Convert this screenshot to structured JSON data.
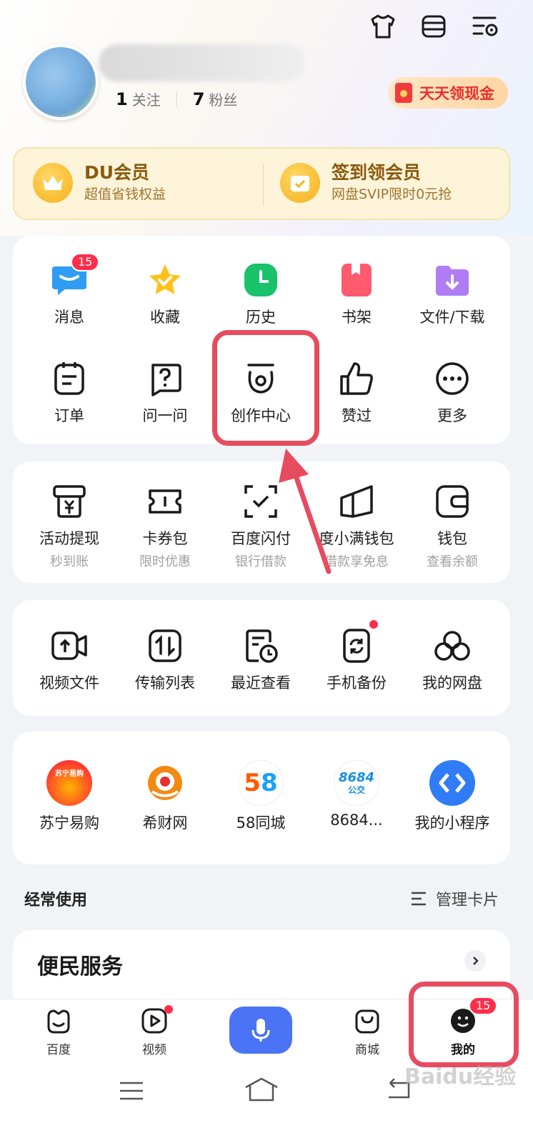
{
  "header": {
    "icons": [
      "shirt-icon",
      "list-icon",
      "settings-icon"
    ]
  },
  "profile": {
    "following_count": "1",
    "following_label": "关注",
    "followers_count": "7",
    "followers_label": "粉丝",
    "cash_button": "天天领现金"
  },
  "vip": {
    "left_title": "DU会员",
    "left_subtitle": "超值省钱权益",
    "right_title": "签到领会员",
    "right_subtitle": "网盘SVIP限时0元抢"
  },
  "quick": {
    "items": [
      {
        "label": "消息",
        "badge": "15"
      },
      {
        "label": "收藏"
      },
      {
        "label": "历史"
      },
      {
        "label": "书架"
      },
      {
        "label": "文件/下载"
      },
      {
        "label": "订单"
      },
      {
        "label": "问一问"
      },
      {
        "label": "创作中心"
      },
      {
        "label": "赞过"
      },
      {
        "label": "更多"
      }
    ]
  },
  "finance": {
    "items": [
      {
        "label": "活动提现",
        "sub": "秒到账"
      },
      {
        "label": "卡券包",
        "sub": "限时优惠"
      },
      {
        "label": "百度闪付",
        "sub": "银行借款"
      },
      {
        "label": "度小满钱包",
        "sub": "借款享免息"
      },
      {
        "label": "钱包",
        "sub": "查看余额"
      }
    ]
  },
  "tools": {
    "items": [
      {
        "label": "视频文件"
      },
      {
        "label": "传输列表"
      },
      {
        "label": "最近查看"
      },
      {
        "label": "手机备份"
      },
      {
        "label": "我的网盘"
      }
    ]
  },
  "apps": {
    "items": [
      {
        "label": "苏宁易购",
        "logo_text": "苏宁易购"
      },
      {
        "label": "希财网"
      },
      {
        "label": "58同城",
        "logo_text": "58"
      },
      {
        "label": "8684...",
        "logo_text": "8684",
        "logo_sub": "公交"
      },
      {
        "label": "我的小程序"
      }
    ]
  },
  "frequent": {
    "title": "经常使用",
    "manage": "管理卡片"
  },
  "service": {
    "title": "便民服务"
  },
  "tabbar": {
    "items": [
      {
        "label": "百度"
      },
      {
        "label": "视频"
      },
      {
        "label": "商城"
      },
      {
        "label": "我的",
        "badge": "15"
      }
    ]
  },
  "watermark": "Baidu经验",
  "colors": {
    "accent_red": "#e64b5f",
    "badge_red": "#ff2d4b",
    "mic_blue": "#4a74f5",
    "vip_bg": "#fdf4d9"
  }
}
